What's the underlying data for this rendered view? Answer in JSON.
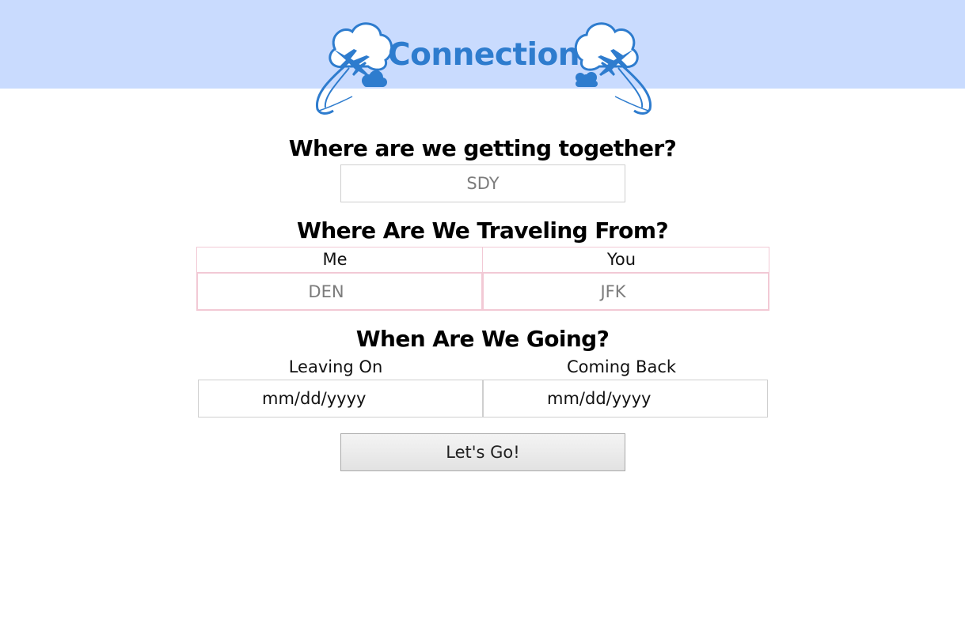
{
  "header": {
    "title": "Connection",
    "background_color": "#c9dbfe",
    "brand_color": "#2e7cce",
    "logo_icons": [
      "cloud-airplane-icon",
      "cloud-airplane-icon"
    ]
  },
  "destination": {
    "heading": "Where are we getting together?",
    "placeholder": "SDY"
  },
  "origins": {
    "heading": "Where Are We Traveling From?",
    "me_label": "Me",
    "me_placeholder": "DEN",
    "you_label": "You",
    "you_placeholder": "JFK"
  },
  "dates": {
    "heading": "When Are We Going?",
    "leaving_label": "Leaving On",
    "leaving_value": "mm/dd/yyyy",
    "returning_label": "Coming Back",
    "returning_value": "mm/dd/yyyy"
  },
  "submit": {
    "label": "Let's Go!"
  }
}
